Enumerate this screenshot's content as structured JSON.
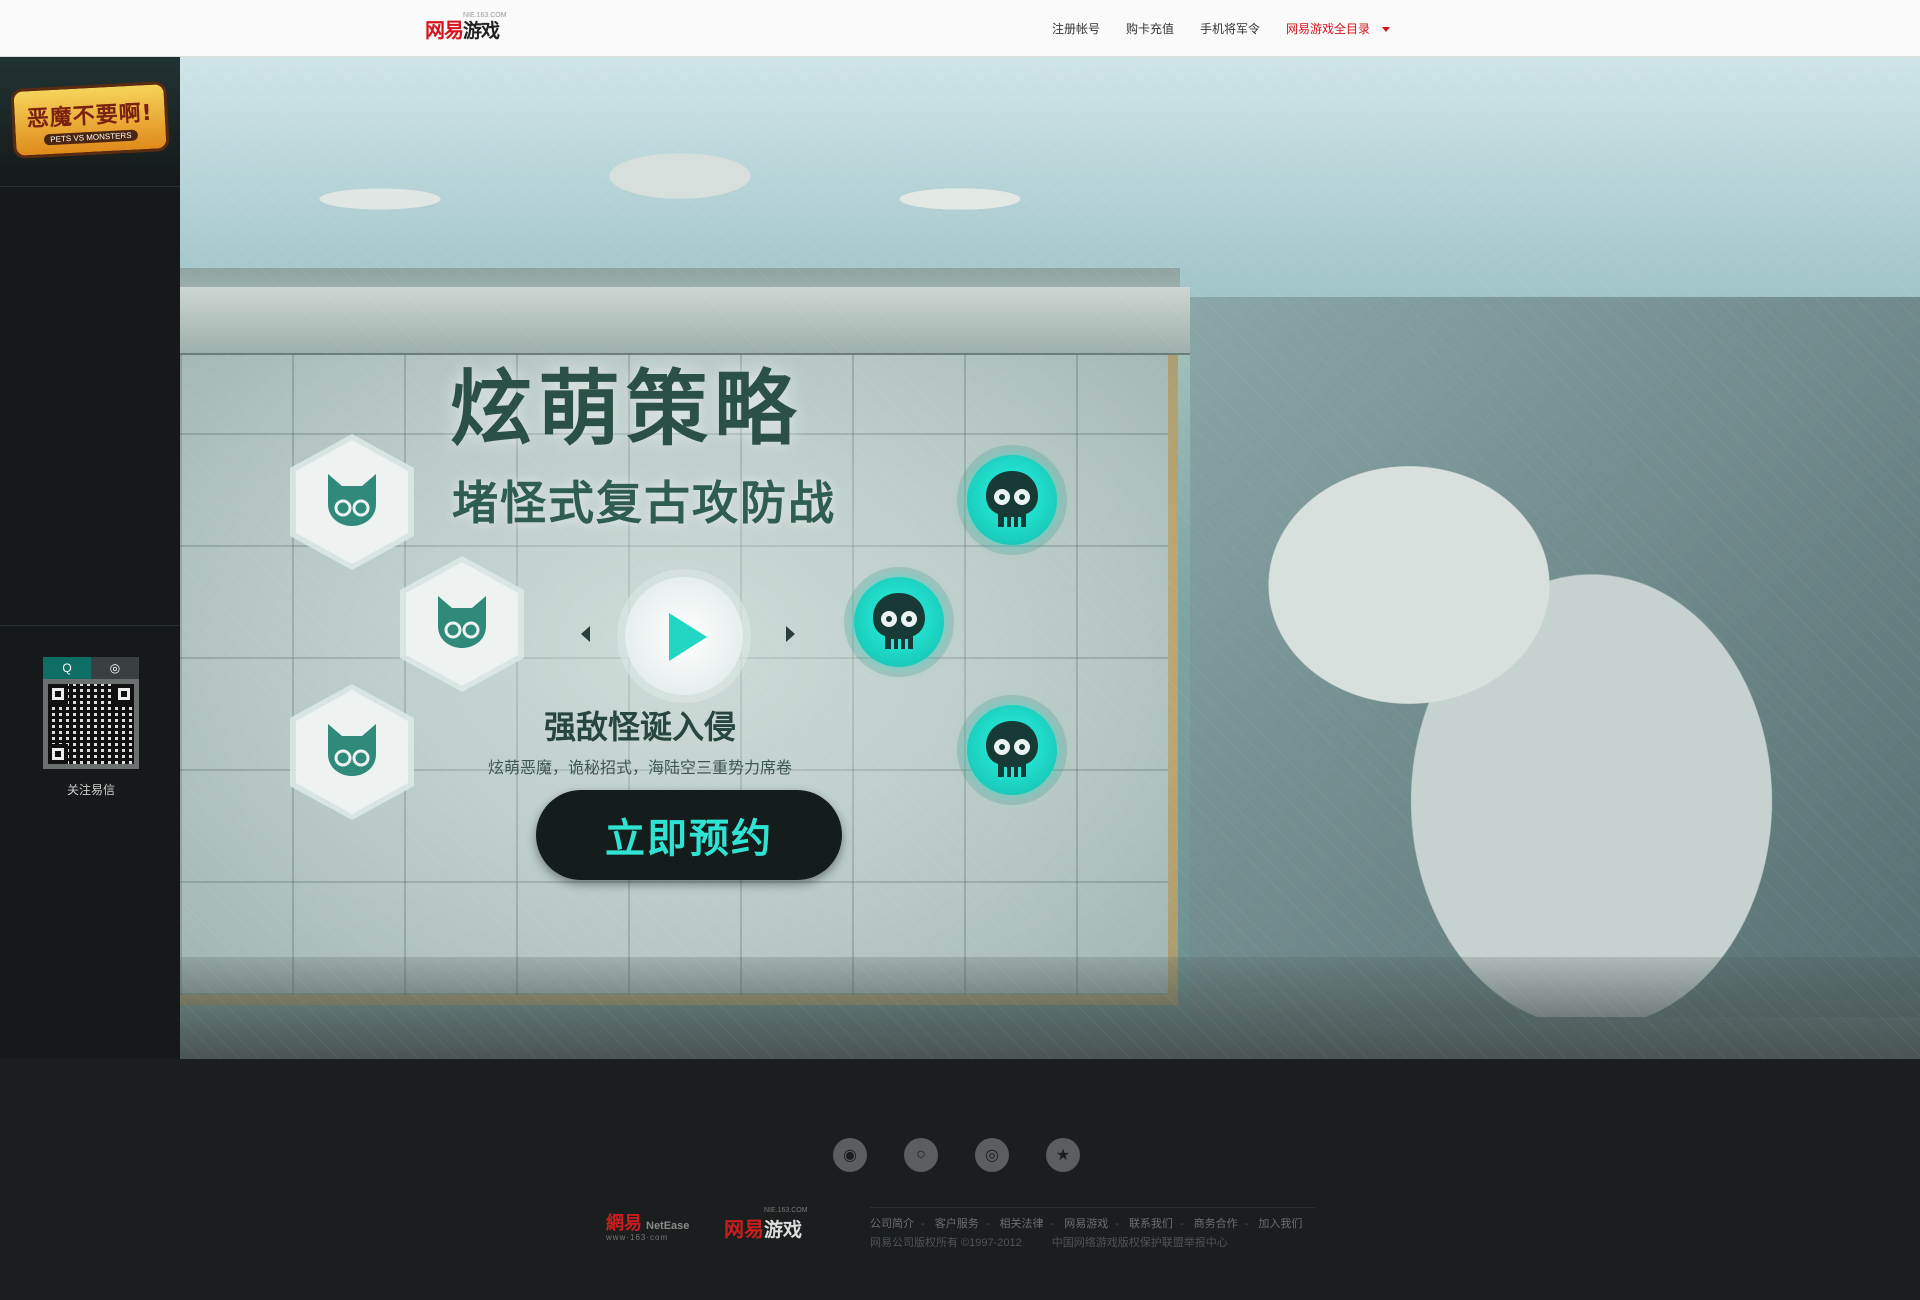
{
  "topbar": {
    "logo_red": "网易",
    "logo_game": "游戏",
    "logo_domain": "NIE.163.COM",
    "nav": [
      "注册帐号",
      "购卡充值",
      "手机将军令",
      "网易游戏全目录"
    ]
  },
  "sidebar": {
    "game_logo_title": "恶魔不要啊!",
    "game_logo_subtitle": "PETS VS MONSTERS",
    "qr_tab_qq": "Q",
    "qr_tab_wechat": "◎",
    "qr_caption": "关注易信"
  },
  "hero": {
    "headline": "炫萌策略",
    "subline": "堵怪式复古攻防战",
    "feature_title": "强敌怪诞入侵",
    "feature_desc": "炫萌恶魔，诡秘招式，海陆空三重势力席卷",
    "reserve_label": "立即预约"
  },
  "footer": {
    "social_icons": [
      "wechat-icon",
      "qq-icon",
      "weibo-icon",
      "star-icon"
    ],
    "netease_cn": "網易",
    "netease_en": "NetEase",
    "netease_url": "www·163·com",
    "nie_red": "网易",
    "nie_white": "游戏",
    "nie_domain": "NIE.163.COM",
    "links": [
      "公司简介",
      "客户服务",
      "相关法律",
      "网易游戏",
      "联系我们",
      "商务合作",
      "加入我们"
    ],
    "copyright": "网易公司版权所有 ©1997-2012",
    "alliance": "中国网络游戏版权保护联盟举报中心"
  },
  "colors": {
    "accent_cyan": "#2fe3d3",
    "netease_red": "#d6141c",
    "dark_bg": "#1b1e1e"
  }
}
